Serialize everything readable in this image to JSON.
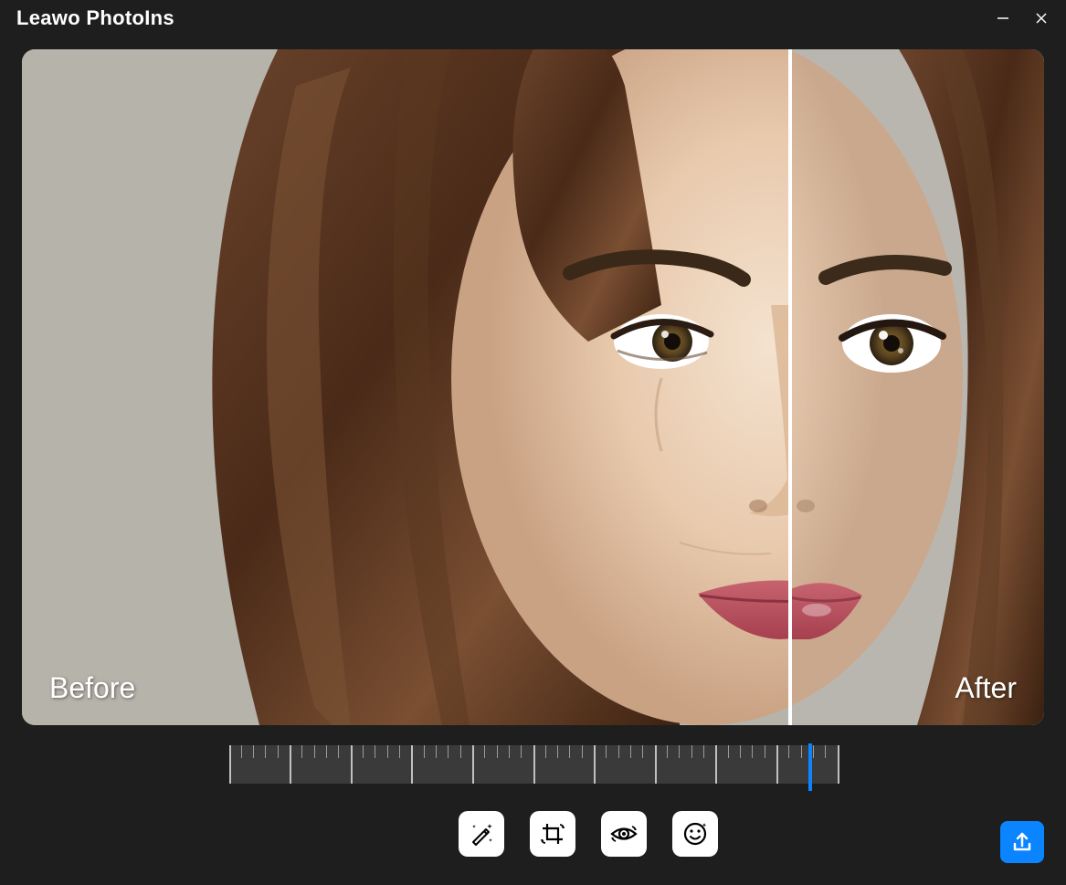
{
  "app": {
    "title": "Leawo PhotoIns"
  },
  "preview": {
    "before_label": "Before",
    "after_label": "After",
    "divider_position_percent": 75
  },
  "ruler": {
    "handle_position_percent": 95.3
  },
  "tools": {
    "auto_enhance": "auto-enhance",
    "crop_rotate": "crop-rotate",
    "eye_fix": "eye-fix",
    "face_retouch": "face-retouch"
  },
  "colors": {
    "accent": "#0a84ff",
    "bg": "#1e1e1e",
    "panel": "#3a3a3a"
  }
}
